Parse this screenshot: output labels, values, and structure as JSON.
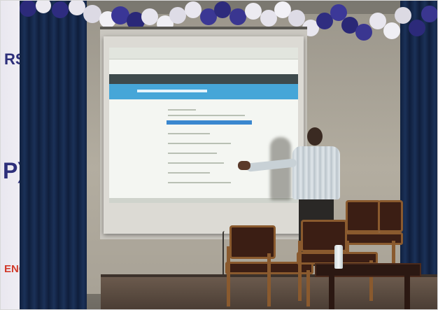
{
  "banner": {
    "text_top": "RS",
    "text_middle": "P)",
    "text_bottom": "ENCE"
  },
  "colors": {
    "banner_text": "#2d2f7a",
    "banner_accent": "#d13a2a",
    "curtain": "#13244a",
    "projected_hero": "#46a6d8",
    "chair_wood": "#8a5a2e"
  }
}
